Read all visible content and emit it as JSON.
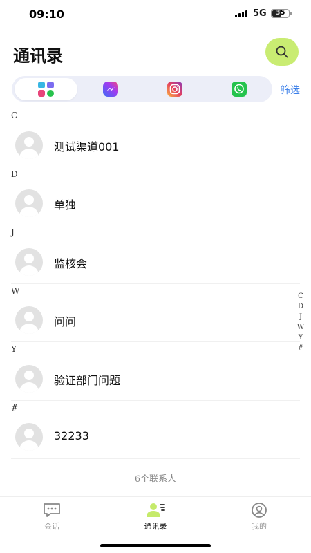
{
  "status_bar": {
    "time": "09:10",
    "network": "5G",
    "battery": "35"
  },
  "header": {
    "title": "通讯录",
    "search_icon": "search-icon"
  },
  "channels": {
    "items": [
      {
        "name": "all-apps",
        "icon": "app-grid-icon",
        "active": true
      },
      {
        "name": "messenger",
        "icon": "messenger-icon",
        "active": false
      },
      {
        "name": "instagram",
        "icon": "instagram-icon",
        "active": false
      },
      {
        "name": "whatsapp",
        "icon": "whatsapp-icon",
        "active": false
      }
    ],
    "filter_label": "筛选"
  },
  "sections": [
    {
      "letter": "C",
      "contacts": [
        {
          "name": "测试渠道001"
        }
      ]
    },
    {
      "letter": "D",
      "contacts": [
        {
          "name": "单独"
        }
      ]
    },
    {
      "letter": "J",
      "contacts": [
        {
          "name": "监核会"
        }
      ]
    },
    {
      "letter": "W",
      "contacts": [
        {
          "name": "问问"
        }
      ]
    },
    {
      "letter": "Y",
      "contacts": [
        {
          "name": "验证部门问题"
        }
      ]
    },
    {
      "letter": "#",
      "contacts": [
        {
          "name": "32233"
        }
      ]
    }
  ],
  "contact_count": "6个联系人",
  "alpha_index": [
    "C",
    "D",
    "J",
    "W",
    "Y",
    "#"
  ],
  "tabs": [
    {
      "label": "会话",
      "icon": "chat-icon",
      "active": false
    },
    {
      "label": "通讯录",
      "icon": "contacts-icon",
      "active": true
    },
    {
      "label": "我的",
      "icon": "profile-icon",
      "active": false
    }
  ],
  "colors": {
    "accent": "#c9ec72",
    "filter": "#3a7ee8",
    "active_tab_icon": "#c5ea6a"
  }
}
